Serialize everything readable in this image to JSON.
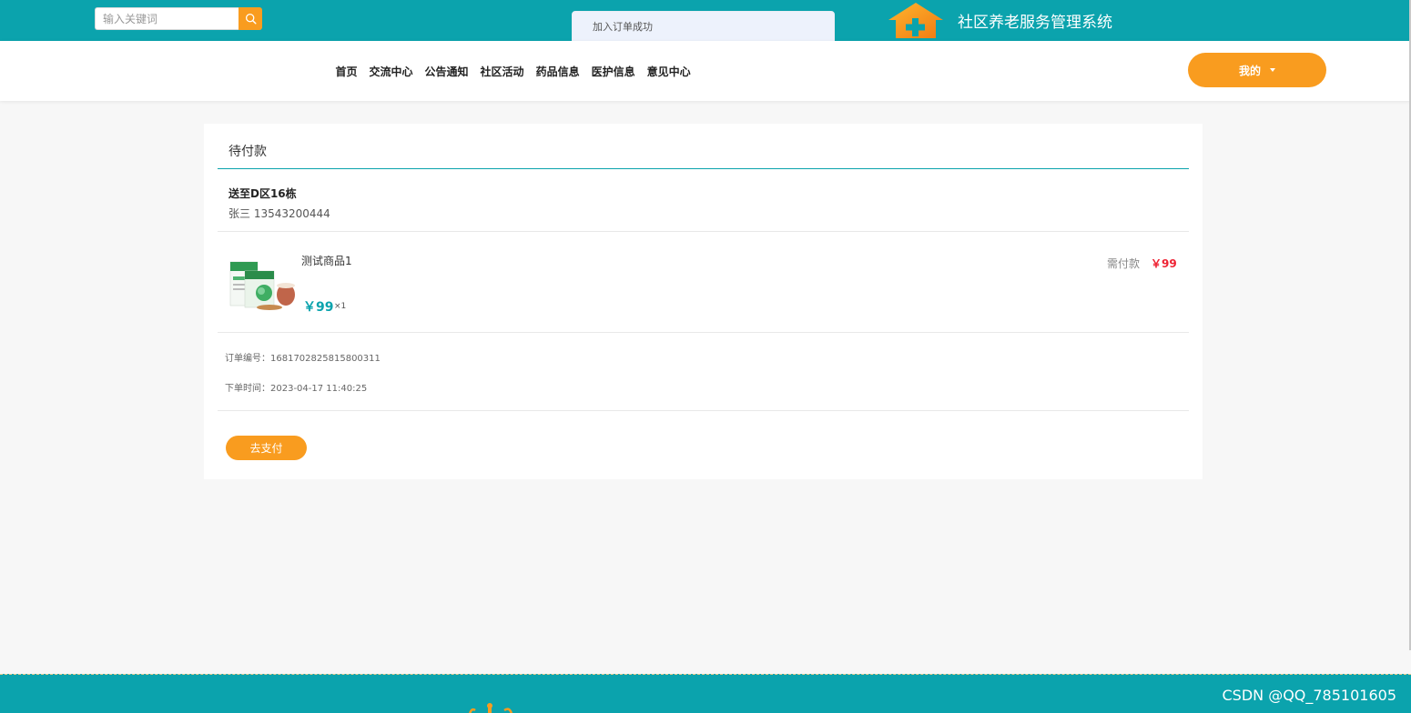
{
  "header": {
    "search_placeholder": "输入关键词",
    "system_title": "社区养老服务管理系统"
  },
  "toast": {
    "message": "加入订单成功"
  },
  "nav": {
    "items": [
      "首页",
      "交流中心",
      "公告通知",
      "社区活动",
      "药品信息",
      "医护信息",
      "意见中心"
    ],
    "user_label": "我的"
  },
  "order": {
    "status_title": "待付款",
    "address": "送至D区16栋",
    "contact": "张三 13543200444",
    "product": {
      "name": "测试商品1",
      "price": "￥99",
      "quantity": "×1"
    },
    "need_pay_label": "需付款",
    "need_pay_amount": "￥99",
    "order_no_label": "订单编号：",
    "order_no": "1681702825815800311",
    "order_time_label": "下单时间：",
    "order_time": "2023-04-17 11:40:25",
    "pay_button": "去支付"
  },
  "footer": {
    "watermark": "CSDN @QQ_785101605"
  },
  "colors": {
    "primary": "#0ba3ad",
    "accent": "#f99c1f",
    "price_red": "#ee2233"
  },
  "icons": {
    "search": "search-icon",
    "logo": "house-plus-logo",
    "caret": "caret-down-icon"
  }
}
